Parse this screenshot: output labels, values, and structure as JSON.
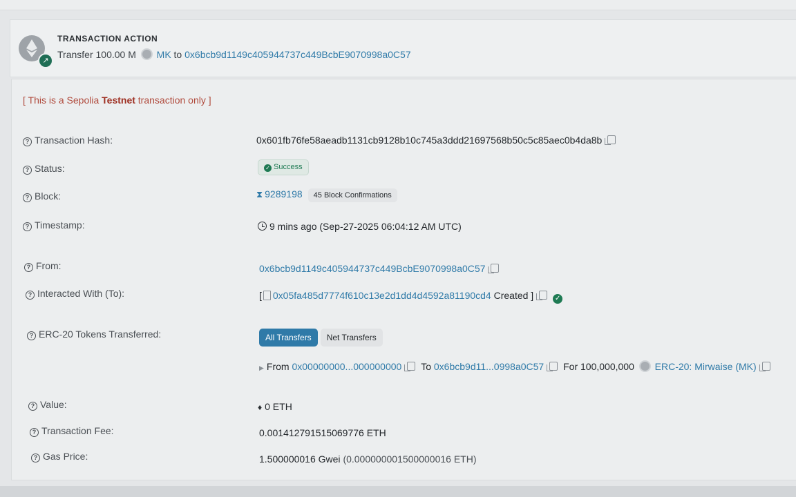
{
  "action": {
    "title": "TRANSACTION ACTION",
    "prefix": "Transfer 100.00 M",
    "token": "MK",
    "to_word": "to",
    "address": "0x6bcb9d1149c405944737c449BcbE9070998a0C57"
  },
  "testnet": {
    "open": "[ This is a Sepolia ",
    "bold": "Testnet",
    "close": " transaction only ]"
  },
  "labels": {
    "hash": "Transaction Hash:",
    "status": "Status:",
    "block": "Block:",
    "timestamp": "Timestamp:",
    "from": "From:",
    "to": "Interacted With (To):",
    "erc20": "ERC-20 Tokens Transferred:",
    "value": "Value:",
    "fee": "Transaction Fee:",
    "gas": "Gas Price:"
  },
  "values": {
    "hash": "0x601fb76fe58aeadb1131cb9128b10c745a3ddd21697568b50c5c85aec0b4da8b",
    "status": "Success",
    "block_number": "9289198",
    "block_confirmations": "45 Block Confirmations",
    "timestamp": "9 mins ago (Sep-27-2025 06:04:12 AM UTC)",
    "from": "0x6bcb9d1149c405944737c449BcbE9070998a0C57",
    "to_address": "0x05fa485d7774f610c13e2d1dd4d4592a81190cd4",
    "to_suffix": "Created ]",
    "value": "0 ETH",
    "fee": "0.001412791515069776 ETH",
    "gas_main": "1.500000016 Gwei",
    "gas_paren": "(0.000000001500000016 ETH)"
  },
  "transfers": {
    "tabs": [
      "All Transfers",
      "Net Transfers"
    ],
    "from_label": "From",
    "from_addr": "0x00000000...000000000",
    "to_label": "To",
    "to_addr": "0x6bcb9d11...0998a0C57",
    "for_label": "For",
    "amount": "100,000,000",
    "token_name": "ERC-20: Mirwaise (MK)"
  }
}
